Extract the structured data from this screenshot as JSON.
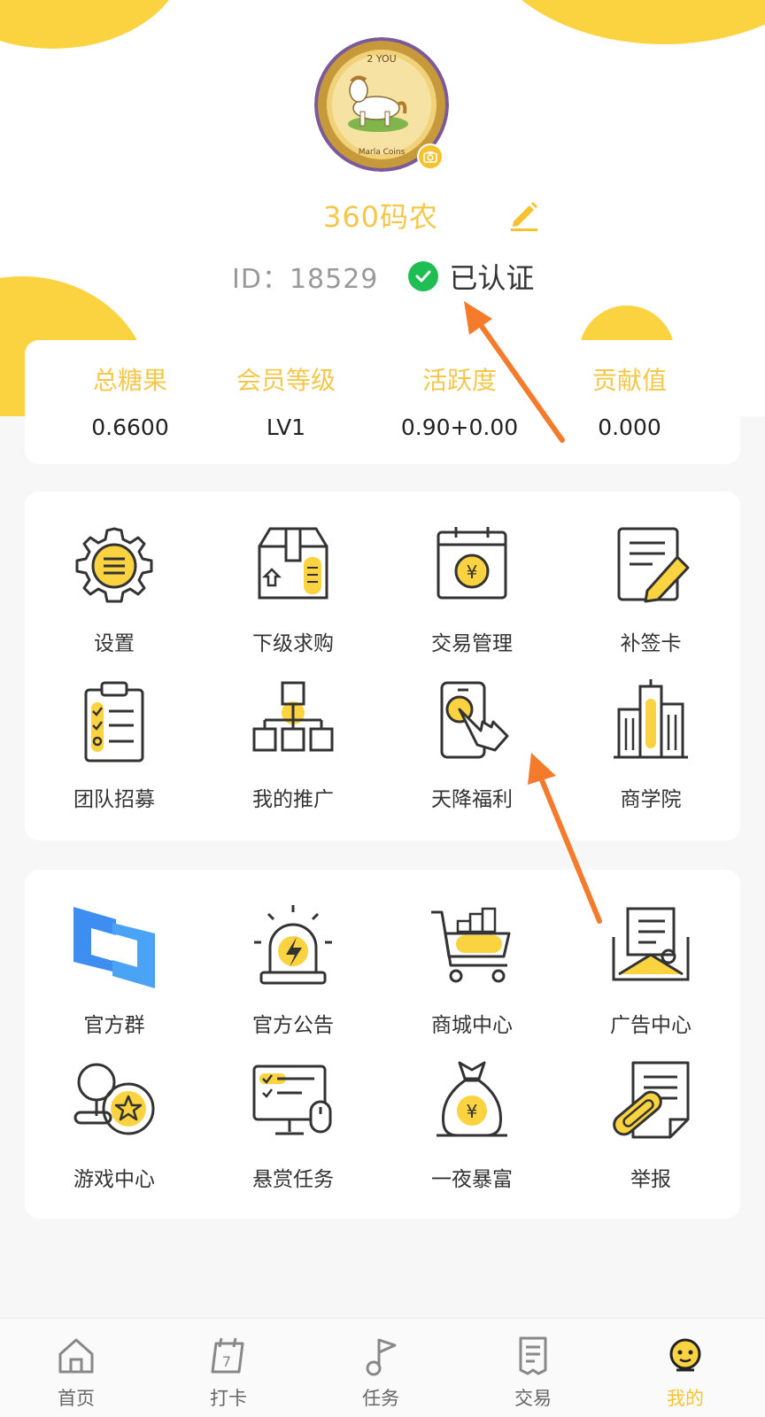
{
  "profile": {
    "avatar_text_top": "2 YOU",
    "avatar_text_bottom": "Marla Coins",
    "nickname": "360码农",
    "id_text": "ID：18529",
    "verified_text": "已认证"
  },
  "stats": [
    {
      "label": "总糖果",
      "value": "0.6600"
    },
    {
      "label": "会员等级",
      "value": "LV1"
    },
    {
      "label": "活跃度",
      "value": "0.90+0.00"
    },
    {
      "label": "贡献值",
      "value": "0.000"
    }
  ],
  "menu1": [
    {
      "label": "设置",
      "icon": "gear-icon"
    },
    {
      "label": "下级求购",
      "icon": "package-icon"
    },
    {
      "label": "交易管理",
      "icon": "yuan-calendar-icon"
    },
    {
      "label": "补签卡",
      "icon": "note-pencil-icon"
    },
    {
      "label": "团队招募",
      "icon": "clipboard-icon"
    },
    {
      "label": "我的推广",
      "icon": "org-chart-icon"
    },
    {
      "label": "天降福利",
      "icon": "phone-tap-icon"
    },
    {
      "label": "商学院",
      "icon": "building-icon"
    }
  ],
  "menu2": [
    {
      "label": "官方群",
      "icon": "group-logo-icon"
    },
    {
      "label": "官方公告",
      "icon": "alarm-light-icon"
    },
    {
      "label": "商城中心",
      "icon": "cart-icon"
    },
    {
      "label": "广告中心",
      "icon": "envelope-icon"
    },
    {
      "label": "游戏中心",
      "icon": "game-coin-icon"
    },
    {
      "label": "悬赏任务",
      "icon": "monitor-task-icon"
    },
    {
      "label": "一夜暴富",
      "icon": "money-bag-icon"
    },
    {
      "label": "举报",
      "icon": "report-clip-icon"
    }
  ],
  "tabs": [
    {
      "label": "首页",
      "icon": "home-icon",
      "active": false
    },
    {
      "label": "打卡",
      "icon": "calendar-checkin-icon",
      "active": false
    },
    {
      "label": "任务",
      "icon": "task-flag-icon",
      "active": false
    },
    {
      "label": "交易",
      "icon": "receipt-icon",
      "active": false
    },
    {
      "label": "我的",
      "icon": "profile-face-icon",
      "active": true
    }
  ],
  "colors": {
    "accent": "#f3c84a",
    "brand_yellow": "#fbd341",
    "verified_green": "#1fbe55",
    "annotation_arrow": "#f47a2c"
  }
}
